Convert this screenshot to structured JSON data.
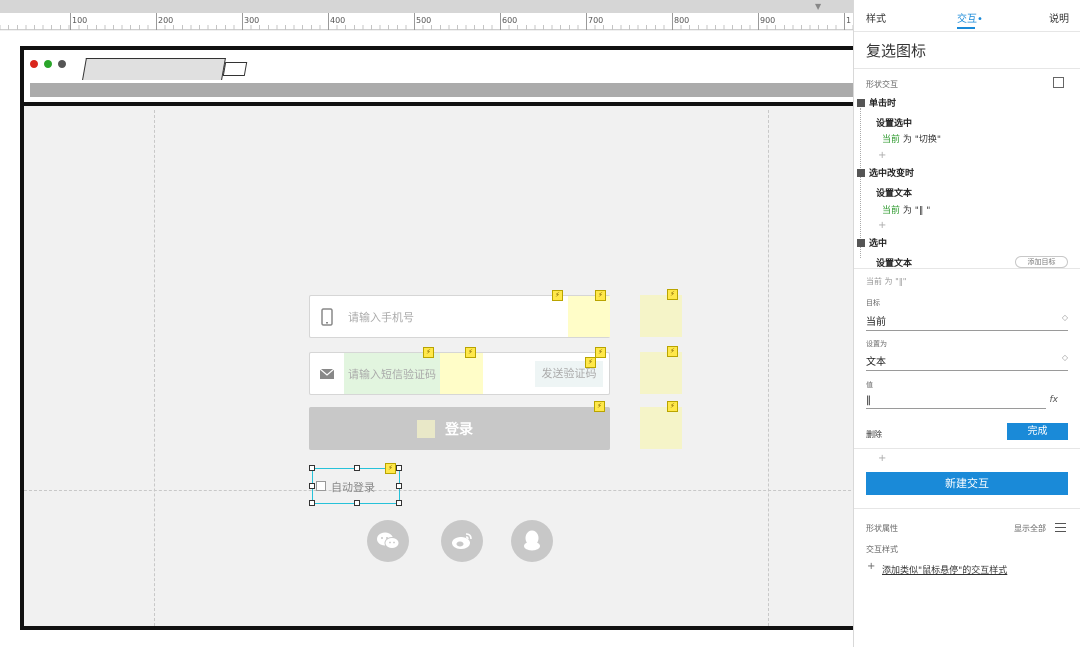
{
  "ruler": {
    "labels": [
      "100",
      "200",
      "300",
      "400",
      "500",
      "600",
      "700",
      "800",
      "900",
      "1"
    ]
  },
  "canvas": {
    "phone_placeholder": "请输入手机号",
    "sms_placeholder": "请输入短信验证码",
    "send_code_label": "发送验证码",
    "login_label": "登录",
    "auto_login_label": "自动登录",
    "flash_glyph": "⚡",
    "social_icons": [
      "wechat-icon",
      "weibo-icon",
      "qq-icon"
    ]
  },
  "panel": {
    "tabs": {
      "style": "样式",
      "interaction": "交互•",
      "notes": "说明"
    },
    "title": "复选图标",
    "section_label": "形状交互",
    "events": [
      {
        "name": "单击时",
        "action": "设置选中",
        "detail_prefix": "当前",
        "detail_suffix": " 为 \"切换\""
      },
      {
        "name": "选中改变时",
        "action": "设置文本",
        "detail_prefix": "当前",
        "detail_suffix": " 为 \"‖ \""
      },
      {
        "name": "选中",
        "action": "设置文本"
      }
    ],
    "add_target": "添加目标",
    "current_detail": "当前 为 \"‖\"",
    "target_label": "目标",
    "target_value": "当前",
    "setas_label": "设置为",
    "setas_value": "文本",
    "value_label": "值",
    "value_value": "‖",
    "fx_glyph": "fx",
    "delete_label": "删除",
    "done_label": "完成",
    "new_interaction_label": "新建交互",
    "shape_props_label": "形状属性",
    "show_all_label": "显示全部",
    "interaction_style_label": "交互样式",
    "add_style_link": "添加类似\"鼠标悬停\"的交互样式",
    "plus_glyph": "+",
    "accent_color": "#1a8ad8"
  }
}
